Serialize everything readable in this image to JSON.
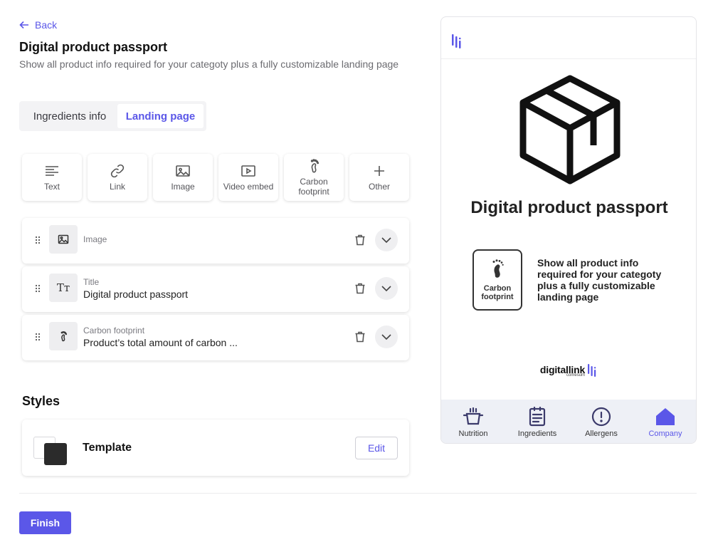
{
  "header": {
    "back_label": "Back",
    "title": "Digital product passport",
    "description": "Show all product info required for your categoty plus a fully customizable landing page"
  },
  "tabs": [
    {
      "label": "Ingredients info",
      "active": false
    },
    {
      "label": "Landing page",
      "active": true
    }
  ],
  "blocks": [
    {
      "label": "Text",
      "icon": "text-lines-icon"
    },
    {
      "label": "Link",
      "icon": "link-icon"
    },
    {
      "label": "Image",
      "icon": "image-icon"
    },
    {
      "label": "Video embed",
      "icon": "video-play-icon"
    },
    {
      "label": "Carbon footprint",
      "icon": "footprint-icon"
    },
    {
      "label": "Other",
      "icon": "plus-icon"
    }
  ],
  "rows": [
    {
      "kind": "Image",
      "value": "",
      "icon": "image-icon"
    },
    {
      "kind": "Title",
      "value": "Digital product passport",
      "icon": "text-size-icon"
    },
    {
      "kind": "Carbon footprint",
      "value": "Product’s total amount of carbon ...",
      "icon": "footprint-icon"
    }
  ],
  "row_icon_text": "Tт",
  "styles": {
    "title": "Styles",
    "template_label": "Template",
    "edit_label": "Edit",
    "swatch_dark": "#2b2b2b"
  },
  "finish_label": "Finish",
  "preview": {
    "title": "Digital product passport",
    "carbon_card_label": "Carbon footprint",
    "carbon_text": "Show all product info required for your categoty plus a fully customizable landing page",
    "brand_name": "digitallink",
    "brand_sub": "comesum",
    "nav": [
      {
        "label": "Nutrition",
        "icon": "pot-icon",
        "active": false
      },
      {
        "label": "Ingredients",
        "icon": "clipboard-list-icon",
        "active": false
      },
      {
        "label": "Allergens",
        "icon": "alert-circle-icon",
        "active": false
      },
      {
        "label": "Company",
        "icon": "home-icon",
        "active": true
      }
    ]
  },
  "colors": {
    "accent": "#5b57e8",
    "nav_bg": "#eef0f6",
    "nav_icon": "#3b3a6b"
  }
}
